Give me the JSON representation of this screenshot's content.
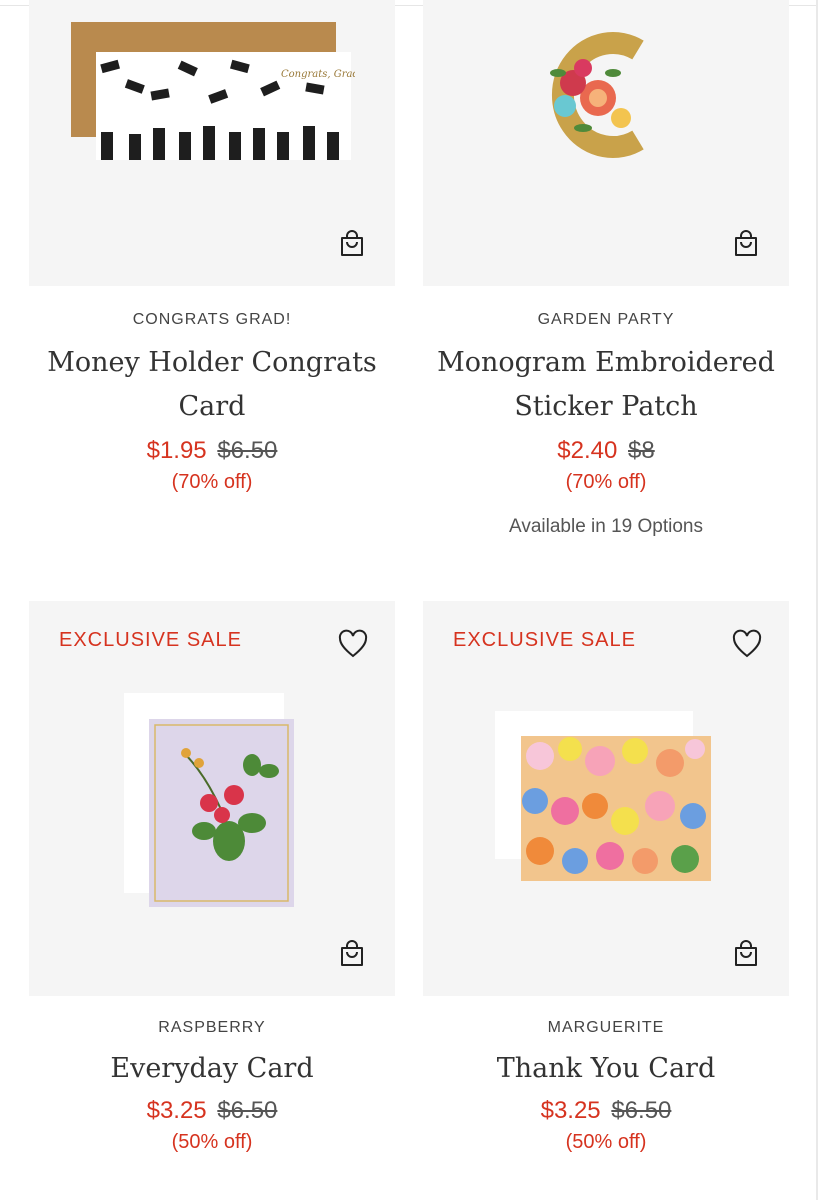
{
  "products": [
    {
      "category": "CONGRATS GRAD!",
      "title_line1": "Money Holder Congrats",
      "title_line2": "Card",
      "sale_price": "$1.95",
      "original_price": "$6.50",
      "discount": "(70% off)",
      "art_text": "Congrats, Grad!",
      "image_icon": "graduation-card-image",
      "cart_icon": "shopping-bag-icon"
    },
    {
      "category": "GARDEN PARTY",
      "title_line1": "Monogram Embroidered",
      "title_line2": "Sticker Patch",
      "sale_price": "$2.40",
      "original_price": "$8",
      "discount": "(70% off)",
      "options": "Available in 19 Options",
      "image_icon": "monogram-c-patch-image",
      "cart_icon": "shopping-bag-icon"
    },
    {
      "badge": "EXCLUSIVE SALE",
      "category": "RASPBERRY",
      "title_line1": "Everyday Card",
      "sale_price": "$3.25",
      "original_price": "$6.50",
      "discount": "(50% off)",
      "image_icon": "raspberry-card-image",
      "wishlist_icon": "heart-icon",
      "cart_icon": "shopping-bag-icon"
    },
    {
      "badge": "EXCLUSIVE SALE",
      "category": "MARGUERITE",
      "title_line1": "Thank You Card",
      "sale_price": "$3.25",
      "original_price": "$6.50",
      "discount": "(50% off)",
      "image_icon": "floral-card-image",
      "wishlist_icon": "heart-icon",
      "cart_icon": "shopping-bag-icon"
    }
  ],
  "colors": {
    "sale_red": "#d6331f",
    "image_bg": "#f5f5f5",
    "text_dark": "#333333"
  }
}
